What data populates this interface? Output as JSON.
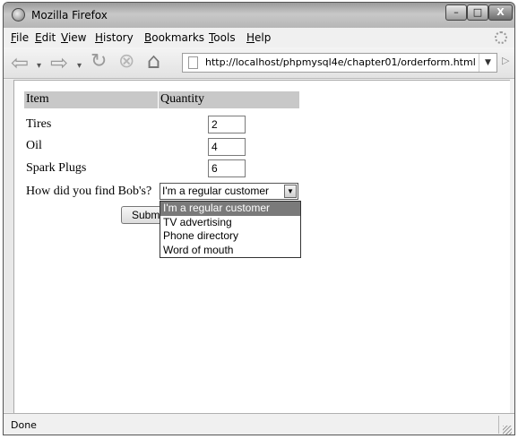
{
  "window": {
    "title": "Mozilla Firefox",
    "minimize_glyph": "–",
    "maximize_glyph": "□",
    "close_glyph": "X"
  },
  "menu": {
    "items": [
      "File",
      "Edit",
      "View",
      "History",
      "Bookmarks",
      "Tools",
      "Help"
    ]
  },
  "toolbar": {
    "url": "http://localhost/phpmysql4e/chapter01/orderform.html",
    "back_glyph": "⇦",
    "forward_glyph": "⇨",
    "dropdown_glyph": "▾",
    "reload_glyph": "↻",
    "stop_glyph": "⊗",
    "home_glyph": "⌂",
    "url_dropdown_glyph": "▼",
    "go_glyph": "▷"
  },
  "form": {
    "header_item": "Item",
    "header_quantity": "Quantity",
    "rows": [
      {
        "label": "Tires",
        "value": "2"
      },
      {
        "label": "Oil",
        "value": "4"
      },
      {
        "label": "Spark Plugs",
        "value": "6"
      }
    ],
    "find_label": "How did you find Bob's?",
    "find_selected": "I'm a regular customer",
    "find_options": [
      "I'm a regular customer",
      "TV advertising",
      "Phone directory",
      "Word of mouth"
    ],
    "submit_label": "Submit Order",
    "select_arrow_glyph": "▼"
  },
  "status": {
    "text": "Done"
  },
  "colors": {
    "header_bg": "#c8c8c8",
    "highlight_bg": "#7a7a7a"
  }
}
